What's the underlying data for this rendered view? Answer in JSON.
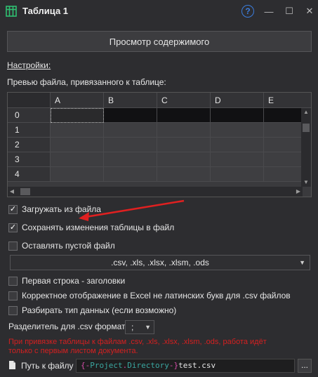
{
  "window": {
    "title": "Таблица 1",
    "help_icon": "?",
    "minimize_glyph": "—",
    "maximize_glyph": "☐",
    "close_glyph": "✕"
  },
  "view_button": "Просмотр содержимого",
  "settings_label": "Настройки:",
  "preview_label": "Превью файла, привязанного к таблице:",
  "grid": {
    "columns": [
      "A",
      "B",
      "C",
      "D",
      "E"
    ],
    "rows": [
      "0",
      "1",
      "2",
      "3",
      "4"
    ]
  },
  "options": {
    "load_from_file": {
      "label": "Загружать из файла",
      "checked": true
    },
    "save_changes": {
      "label": "Сохранять изменения таблицы в файл",
      "checked": true
    },
    "keep_empty": {
      "label": "Оставлять пустой файл",
      "checked": false
    },
    "file_formats": ".csv, .xls, .xlsx, .xlsm, .ods",
    "first_row_header": {
      "label": "Первая строка - заголовки",
      "checked": false
    },
    "excel_display": {
      "label": "Корректное отображение в Excel не латинских букв для .csv файлов",
      "checked": false
    },
    "parse_types": {
      "label": "Разбирать тип данных (если возможно)",
      "checked": false
    }
  },
  "separator": {
    "label": "Разделитель для .csv формата",
    "value": ";"
  },
  "warning": "При привязке таблицы к файлам .csv, .xls, .xlsx, .xlsm, .ods, работа идёт только с первым листом документа.",
  "path": {
    "label": "Путь к файлу",
    "brace_open": "{-",
    "project": "Project",
    "dot": ".",
    "directory": "Directory",
    "brace_close": "-}",
    "filename": "test.csv",
    "browse": "..."
  },
  "colors": {
    "background": "#2d2d30",
    "warning": "#d42020",
    "annotation_arrow": "#e02020",
    "accent_help": "#3b7ddd",
    "table_icon": "#2fbf71"
  }
}
